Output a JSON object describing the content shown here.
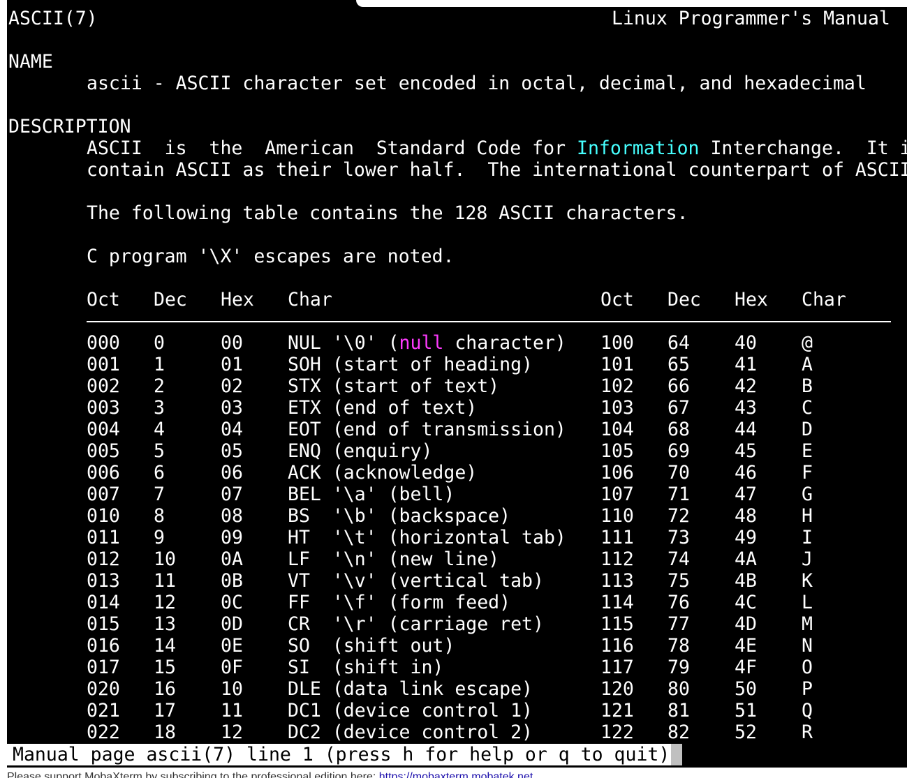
{
  "header": {
    "left": "ASCII(7)",
    "right": "Linux Programmer's Manual"
  },
  "name_section": {
    "heading": "NAME",
    "text": "ascii - ASCII character set encoded in octal, decimal, and hexadecimal"
  },
  "description_section": {
    "heading": "DESCRIPTION",
    "line1_before": "ASCII  is  the  American  Standard Code for ",
    "line1_highlight": "Information",
    "line1_after": " Interchange.  It i",
    "line2": "contain ASCII as their lower half.  The international counterpart of ASCII",
    "para2": "The following table contains the 128 ASCII characters.",
    "para3": "C program '\\X' escapes are noted."
  },
  "table": {
    "headers": [
      "Oct",
      "Dec",
      "Hex",
      "Char",
      "Oct",
      "Dec",
      "Hex",
      "Char"
    ],
    "rows": [
      {
        "oct": "000",
        "dec": "0",
        "hex": "00",
        "char_pre": "NUL '\\0' (",
        "char_hl": "null",
        "char_post": " character)",
        "oct2": "100",
        "dec2": "64",
        "hex2": "40",
        "char2": "@"
      },
      {
        "oct": "001",
        "dec": "1",
        "hex": "01",
        "char_pre": "SOH (start of heading)",
        "char_hl": "",
        "char_post": "",
        "oct2": "101",
        "dec2": "65",
        "hex2": "41",
        "char2": "A"
      },
      {
        "oct": "002",
        "dec": "2",
        "hex": "02",
        "char_pre": "STX (start of text)",
        "char_hl": "",
        "char_post": "",
        "oct2": "102",
        "dec2": "66",
        "hex2": "42",
        "char2": "B"
      },
      {
        "oct": "003",
        "dec": "3",
        "hex": "03",
        "char_pre": "ETX (end of text)",
        "char_hl": "",
        "char_post": "",
        "oct2": "103",
        "dec2": "67",
        "hex2": "43",
        "char2": "C"
      },
      {
        "oct": "004",
        "dec": "4",
        "hex": "04",
        "char_pre": "EOT (end of transmission)",
        "char_hl": "",
        "char_post": "",
        "oct2": "104",
        "dec2": "68",
        "hex2": "44",
        "char2": "D"
      },
      {
        "oct": "005",
        "dec": "5",
        "hex": "05",
        "char_pre": "ENQ (enquiry)",
        "char_hl": "",
        "char_post": "",
        "oct2": "105",
        "dec2": "69",
        "hex2": "45",
        "char2": "E"
      },
      {
        "oct": "006",
        "dec": "6",
        "hex": "06",
        "char_pre": "ACK (acknowledge)",
        "char_hl": "",
        "char_post": "",
        "oct2": "106",
        "dec2": "70",
        "hex2": "46",
        "char2": "F"
      },
      {
        "oct": "007",
        "dec": "7",
        "hex": "07",
        "char_pre": "BEL '\\a' (bell)",
        "char_hl": "",
        "char_post": "",
        "oct2": "107",
        "dec2": "71",
        "hex2": "47",
        "char2": "G"
      },
      {
        "oct": "010",
        "dec": "8",
        "hex": "08",
        "char_pre": "BS  '\\b' (backspace)",
        "char_hl": "",
        "char_post": "",
        "oct2": "110",
        "dec2": "72",
        "hex2": "48",
        "char2": "H"
      },
      {
        "oct": "011",
        "dec": "9",
        "hex": "09",
        "char_pre": "HT  '\\t' (horizontal tab)",
        "char_hl": "",
        "char_post": "",
        "oct2": "111",
        "dec2": "73",
        "hex2": "49",
        "char2": "I"
      },
      {
        "oct": "012",
        "dec": "10",
        "hex": "0A",
        "char_pre": "LF  '\\n' (new line)",
        "char_hl": "",
        "char_post": "",
        "oct2": "112",
        "dec2": "74",
        "hex2": "4A",
        "char2": "J"
      },
      {
        "oct": "013",
        "dec": "11",
        "hex": "0B",
        "char_pre": "VT  '\\v' (vertical tab)",
        "char_hl": "",
        "char_post": "",
        "oct2": "113",
        "dec2": "75",
        "hex2": "4B",
        "char2": "K"
      },
      {
        "oct": "014",
        "dec": "12",
        "hex": "0C",
        "char_pre": "FF  '\\f' (form feed)",
        "char_hl": "",
        "char_post": "",
        "oct2": "114",
        "dec2": "76",
        "hex2": "4C",
        "char2": "L"
      },
      {
        "oct": "015",
        "dec": "13",
        "hex": "0D",
        "char_pre": "CR  '\\r' (carriage ret)",
        "char_hl": "",
        "char_post": "",
        "oct2": "115",
        "dec2": "77",
        "hex2": "4D",
        "char2": "M"
      },
      {
        "oct": "016",
        "dec": "14",
        "hex": "0E",
        "char_pre": "SO  (shift out)",
        "char_hl": "",
        "char_post": "",
        "oct2": "116",
        "dec2": "78",
        "hex2": "4E",
        "char2": "N"
      },
      {
        "oct": "017",
        "dec": "15",
        "hex": "0F",
        "char_pre": "SI  (shift in)",
        "char_hl": "",
        "char_post": "",
        "oct2": "117",
        "dec2": "79",
        "hex2": "4F",
        "char2": "O"
      },
      {
        "oct": "020",
        "dec": "16",
        "hex": "10",
        "char_pre": "DLE (data link escape)",
        "char_hl": "",
        "char_post": "",
        "oct2": "120",
        "dec2": "80",
        "hex2": "50",
        "char2": "P"
      },
      {
        "oct": "021",
        "dec": "17",
        "hex": "11",
        "char_pre": "DC1 (device control 1)",
        "char_hl": "",
        "char_post": "",
        "oct2": "121",
        "dec2": "81",
        "hex2": "51",
        "char2": "Q"
      },
      {
        "oct": "022",
        "dec": "18",
        "hex": "12",
        "char_pre": "DC2 (device control 2)",
        "char_hl": "",
        "char_post": "",
        "oct2": "122",
        "dec2": "82",
        "hex2": "52",
        "char2": "R"
      }
    ]
  },
  "status_bar": {
    "text": "Manual page ascii(7) line 1 (press h for help or q to quit)"
  },
  "footer": {
    "text": "Please support MobaXterm by subscribing to the professional edition here: ",
    "link": "https://mobaxterm.mobatek.net"
  },
  "colors": {
    "background": "#000000",
    "foreground": "#ffffff",
    "highlight_magenta": "#ff3bff",
    "highlight_cyan": "#46ffff"
  }
}
